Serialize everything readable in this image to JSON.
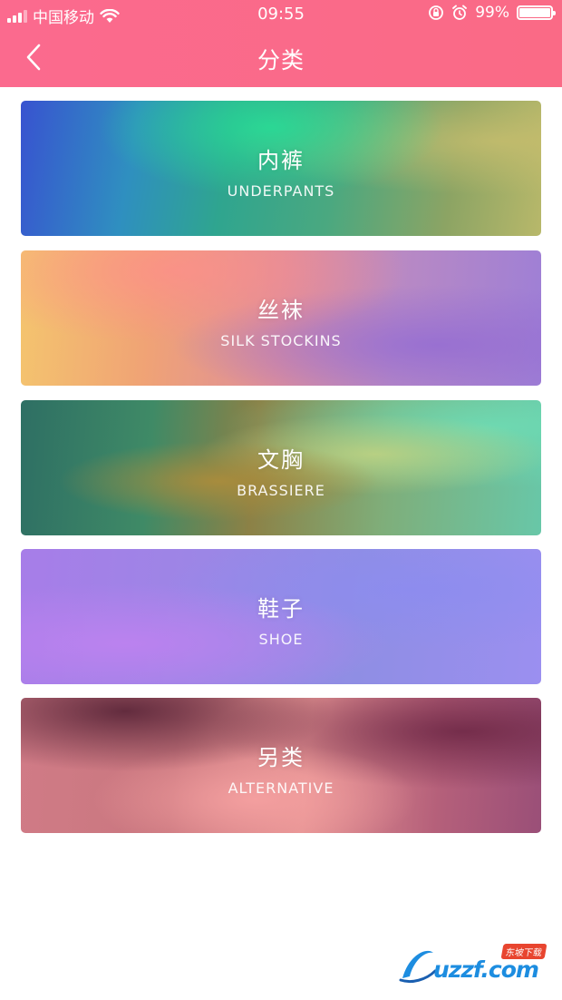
{
  "status_bar": {
    "carrier": "中国移动",
    "time": "09:55",
    "battery_percent": "99%",
    "battery_level": 0.99
  },
  "header": {
    "title": "分类",
    "color": "#fb6a8e"
  },
  "categories": [
    {
      "name": "内裤",
      "subtitle": "UNDERPANTS"
    },
    {
      "name": "丝袜",
      "subtitle": "SILK STOCKINS"
    },
    {
      "name": "文胸",
      "subtitle": "BRASSIERE"
    },
    {
      "name": "鞋子",
      "subtitle": "SHOE"
    },
    {
      "name": "另类",
      "subtitle": "ALTERNATIVE"
    }
  ],
  "watermark": {
    "logo_text": "uzzf.com",
    "badge_text": "东坡下载"
  }
}
